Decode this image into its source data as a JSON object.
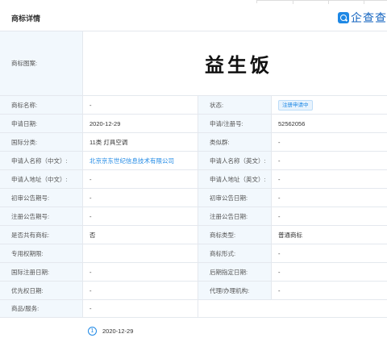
{
  "header": {
    "title": "商标详情",
    "brand_text": "企查查"
  },
  "trademark": {
    "image_label": "商标图案:",
    "image_text": "益生饭"
  },
  "rows": [
    {
      "l1": "商标名称:",
      "v1": "-",
      "l2": "状态:",
      "v2": "注册申请中"
    },
    {
      "l1": "申请日期:",
      "v1": "2020-12-29",
      "l2": "申请/注册号:",
      "v2": "52562056"
    },
    {
      "l1": "国际分类:",
      "v1": "11类 灯具空调",
      "l2": "类似群:",
      "v2": "-"
    },
    {
      "l1": "申请人名称（中文）:",
      "v1": "北京京东世纪信息技术有限公司",
      "l2": "申请人名称（英文）:",
      "v2": "-"
    },
    {
      "l1": "申请人地址（中文）:",
      "v1": "-",
      "l2": "申请人地址（英文）:",
      "v2": "-"
    },
    {
      "l1": "初审公告期号:",
      "v1": "-",
      "l2": "初审公告日期:",
      "v2": "-"
    },
    {
      "l1": "注册公告期号:",
      "v1": "-",
      "l2": "注册公告日期:",
      "v2": "-"
    },
    {
      "l1": "是否共有商标:",
      "v1": "否",
      "l2": "商标类型:",
      "v2": "普通商标"
    },
    {
      "l1": "专用权期限:",
      "v1": "",
      "l2": "商标形式:",
      "v2": "-"
    },
    {
      "l1": "国际注册日期:",
      "v1": "-",
      "l2": "后期指定日期:",
      "v2": "-"
    },
    {
      "l1": "优先权日期:",
      "v1": "-",
      "l2": "代理/办理机构:",
      "v2": "-"
    }
  ],
  "services": {
    "label": "商品/服务:",
    "value": "-"
  },
  "timeline": {
    "step_number": "1",
    "date": "2020-12-29"
  },
  "colors": {
    "accent": "#1e88e5",
    "label_bg": "#f2f8fd",
    "border": "#e4e8ee"
  }
}
